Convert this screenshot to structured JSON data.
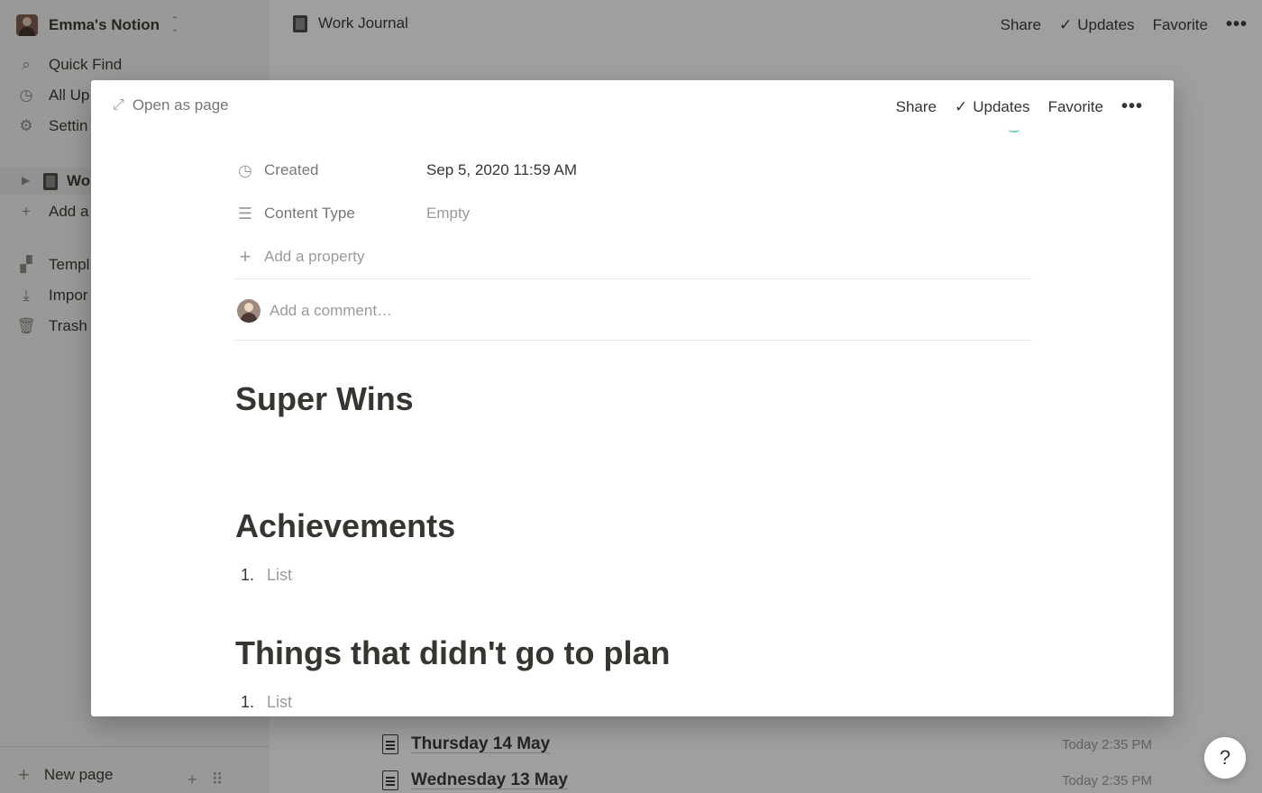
{
  "sidebar": {
    "workspace_name": "Emma's Notion",
    "items": [
      {
        "icon": "search-icon",
        "glyph": "⌕",
        "label": "Quick Find"
      },
      {
        "icon": "clock-icon",
        "glyph": "◷",
        "label": "All Up"
      },
      {
        "icon": "gear-icon",
        "glyph": "⚙",
        "label": "Settin"
      }
    ],
    "tree_item": "Wo",
    "add_label": "Add a",
    "lower_items": [
      {
        "icon": "templates-icon",
        "glyph": "▞",
        "label": "Templ"
      },
      {
        "icon": "import-icon",
        "glyph": "⤓",
        "label": "Impor"
      },
      {
        "icon": "trash-icon",
        "glyph": "🗑",
        "label": "Trash"
      }
    ],
    "new_page_label": "New page"
  },
  "topbar": {
    "page_title": "Work Journal",
    "share": "Share",
    "updates": "Updates",
    "favorite": "Favorite",
    "more": "•••"
  },
  "background_list": [
    {
      "title": "Thursday 14 May",
      "time": "Today 2:35 PM"
    },
    {
      "title": "Wednesday 13 May",
      "time": "Today 2:35 PM"
    }
  ],
  "help_label": "?",
  "modal": {
    "open_as_page": "Open as page",
    "share": "Share",
    "updates": "Updates",
    "favorite": "Favorite",
    "more": "•••",
    "properties": [
      {
        "icon": "clock-icon",
        "glyph": "◷",
        "label": "Created",
        "value": "Sep 5, 2020 11:59 AM",
        "empty": false
      },
      {
        "icon": "list-icon",
        "glyph": "☰",
        "label": "Content Type",
        "value": "Empty",
        "empty": true
      }
    ],
    "add_property": "Add a property",
    "comment_placeholder": "Add a comment…",
    "headings": [
      {
        "text": "Super Wins"
      },
      {
        "text": "Achievements"
      },
      {
        "text": "Things that didn't go to plan"
      }
    ],
    "lists": [
      {
        "num": "1.",
        "text": "List"
      },
      {
        "num": "1.",
        "text": "List"
      }
    ]
  }
}
